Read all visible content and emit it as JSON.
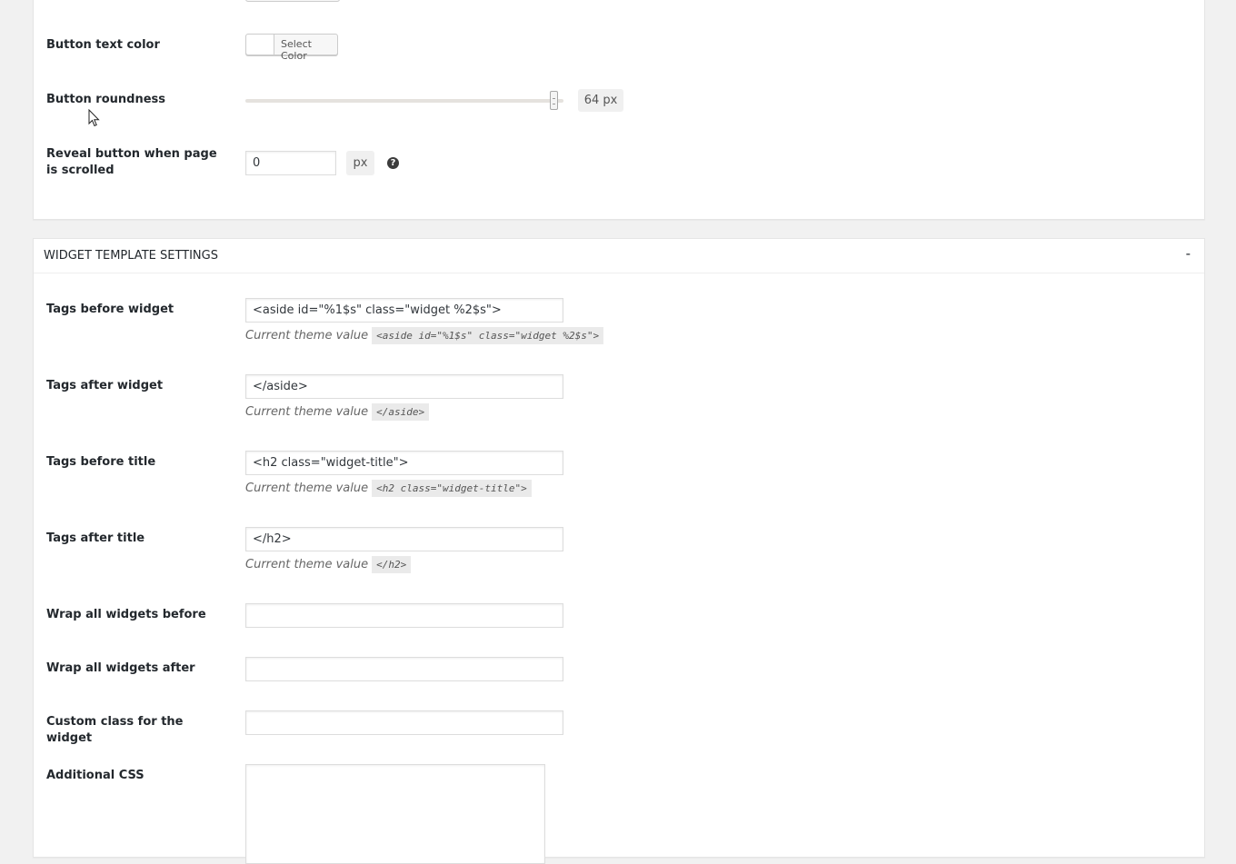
{
  "button_settings": {
    "button_text_color": {
      "label": "Button text color",
      "select_label": "Select Color",
      "swatch_color": "#ffffff"
    },
    "button_roundness": {
      "label": "Button roundness",
      "value": 64,
      "value_display": "64 px",
      "fraction": 0.97
    },
    "reveal_on_scroll": {
      "label": "Reveal button when page is scrolled",
      "value": "0",
      "unit": "px",
      "help_icon": "question-circle-icon",
      "help_symbol": "?"
    }
  },
  "widget_template": {
    "title": "WIDGET TEMPLATE SETTINGS",
    "toggle": "-",
    "hint_prefix": "Current theme value",
    "fields": {
      "tags_before_widget": {
        "label": "Tags before widget",
        "value": "<aside id=\"%1$s\" class=\"widget %2$s\">",
        "theme_value": "<aside id=\"%1$s\" class=\"widget %2$s\">"
      },
      "tags_after_widget": {
        "label": "Tags after widget",
        "value": "</aside>",
        "theme_value": "</aside>"
      },
      "tags_before_title": {
        "label": "Tags before title",
        "value": "<h2 class=\"widget-title\">",
        "theme_value": "<h2 class=\"widget-title\">"
      },
      "tags_after_title": {
        "label": "Tags after title",
        "value": "</h2>",
        "theme_value": "</h2>"
      },
      "wrap_before": {
        "label": "Wrap all widgets before",
        "value": ""
      },
      "wrap_after": {
        "label": "Wrap all widgets after",
        "value": ""
      },
      "custom_class": {
        "label": "Custom class for the widget",
        "value": ""
      },
      "additional_css": {
        "label": "Additional CSS",
        "value": ""
      }
    }
  }
}
